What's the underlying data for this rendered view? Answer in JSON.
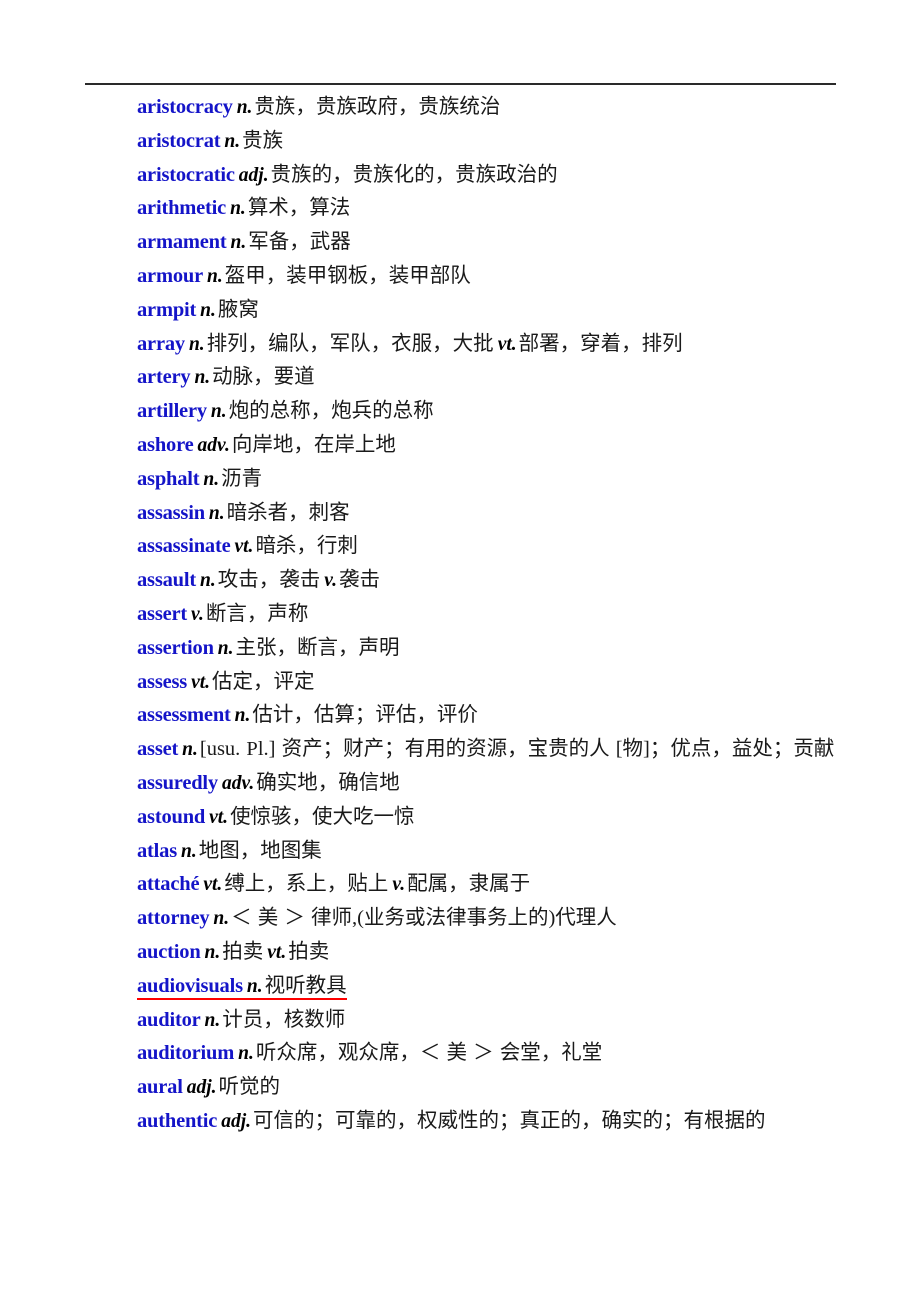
{
  "page": {
    "divider": "horizontal-rule",
    "accent_word_color": "#1414c8",
    "flag_underline_color": "#ff0000"
  },
  "entries": [
    {
      "word": "aristocracy",
      "pos": "n.",
      "def": "贵族，贵族政府，贵族统治",
      "flagged": false
    },
    {
      "word": "aristocrat",
      "pos": "n.",
      "def": "贵族",
      "flagged": false
    },
    {
      "word": "aristocratic",
      "pos": "adj.",
      "def": "贵族的，贵族化的，贵族政治的",
      "flagged": false
    },
    {
      "word": "arithmetic",
      "pos": "n.",
      "def": "算术，算法",
      "flagged": false
    },
    {
      "word": "armament",
      "pos": "n.",
      "def": "军备，武器",
      "flagged": false
    },
    {
      "word": "armour",
      "pos": "n.",
      "def": "盔甲，装甲钢板，装甲部队",
      "flagged": false
    },
    {
      "word": "armpit",
      "pos": "n.",
      "def": "腋窝",
      "flagged": false
    },
    {
      "word": "array",
      "pos": "n.",
      "def": "排列，编队，军队，衣服，大批",
      "pos2": "vt.",
      "def2": "部署，穿着，排列",
      "flagged": false
    },
    {
      "word": "artery",
      "pos": "n.",
      "def": "动脉，要道",
      "flagged": false
    },
    {
      "word": "artillery",
      "pos": "n.",
      "def": "炮的总称，炮兵的总称",
      "flagged": false
    },
    {
      "word": "ashore",
      "pos": "adv.",
      "def": "向岸地，在岸上地",
      "flagged": false
    },
    {
      "word": "asphalt",
      "pos": "n.",
      "def": "沥青",
      "flagged": false
    },
    {
      "word": "assassin",
      "pos": "n.",
      "def": "暗杀者，刺客",
      "flagged": false
    },
    {
      "word": "assassinate",
      "pos": "vt.",
      "def": "暗杀，行刺",
      "flagged": false
    },
    {
      "word": "assault",
      "pos": "n.",
      "def": "攻击，袭击",
      "pos2": "v.",
      "def2": "袭击",
      "flagged": false
    },
    {
      "word": "assert",
      "pos": "v.",
      "def": "断言，声称",
      "flagged": false
    },
    {
      "word": "assertion",
      "pos": "n.",
      "def": "主张，断言，声明",
      "flagged": false
    },
    {
      "word": "assess",
      "pos": "vt.",
      "def": "估定，评定",
      "flagged": false
    },
    {
      "word": "assessment",
      "pos": "n.",
      "def": "估计，估算；评估，评价",
      "flagged": false
    },
    {
      "word": "asset",
      "pos": "n.",
      "def": "[usu. Pl.] 资产；财产；有用的资源，宝贵的人 [物]；优点，益处；贡献",
      "flagged": false
    },
    {
      "word": "assuredly",
      "pos": "adv.",
      "def": "确实地，确信地",
      "flagged": false
    },
    {
      "word": "astound",
      "pos": "vt.",
      "def": "使惊骇，使大吃一惊",
      "flagged": false
    },
    {
      "word": "atlas",
      "pos": "n.",
      "def": "地图，地图集",
      "flagged": false
    },
    {
      "word": "attaché",
      "pos": "vt.",
      "def": "缚上，系上，贴上",
      "pos2": "v.",
      "def2": "配属，隶属于",
      "flagged": false
    },
    {
      "word": "attorney",
      "pos": "n.",
      "def": "＜ 美 ＞ 律师,(业务或法律事务上的)代理人",
      "flagged": false
    },
    {
      "word": "auction",
      "pos": "n.",
      "def": "拍卖",
      "pos2": "vt.",
      "def2": "拍卖",
      "flagged": false
    },
    {
      "word": "audiovisuals",
      "pos": "n.",
      "def": "视听教具",
      "flagged": true
    },
    {
      "word": "auditor",
      "pos": "n.",
      "def": "计员，核数师",
      "flagged": false
    },
    {
      "word": "auditorium",
      "pos": "n.",
      "def": "听众席，观众席，＜ 美 ＞ 会堂，礼堂",
      "flagged": false
    },
    {
      "word": "aural",
      "pos": "adj.",
      "def": "听觉的",
      "flagged": false
    },
    {
      "word": "authentic",
      "pos": "adj.",
      "def": "可信的；可靠的，权威性的；真正的，确实的；有根据的",
      "flagged": false
    }
  ]
}
